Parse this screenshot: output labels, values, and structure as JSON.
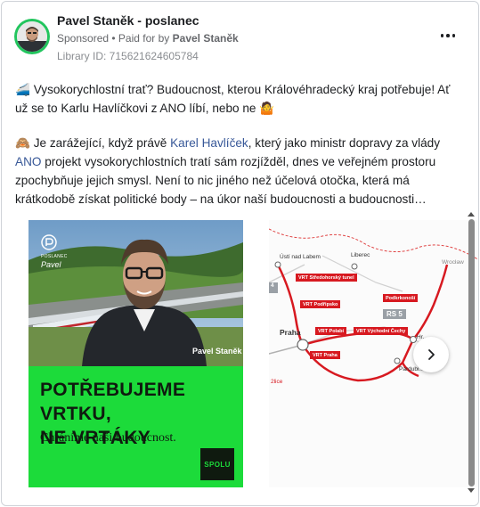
{
  "post": {
    "page_name": "Pavel Staněk - poslanec",
    "sponsored": "Sponsored",
    "paid_for_prefix": "• Paid for by",
    "paid_for_name": "Pavel Staněk",
    "library_id": "Library ID: 715621624605784",
    "more_icon": "more-horizontal-icon"
  },
  "body": {
    "p1_icon": "🚄",
    "p1_text": "Vysokorychlostní trať? Budoucnost, kterou Královéhradecký kraj potřebuje! Ať už se to Karlu Havlíčkovi z ANO líbí, nebo ne",
    "p1_end_icon": "🤷",
    "p2_icon": "🙈",
    "p2_a": "Je zarážející, když právě",
    "p2_link1": "Karel Havlíček",
    "p2_b": ", který jako ministr dopravy za vlády",
    "p2_link2": "ANO",
    "p2_c": "projekt vysokorychlostních tratí sám rozjížděl, dnes ve veřejném prostoru zpochybňuje jejich smysl. Není to nic jiného než účelová otočka, která má krátkodobě získat politické body – na úkor naší budoucnosti a budoucnosti…"
  },
  "ad_creative": {
    "logo_small_text": "POSLANEC",
    "logo_name": "Pavel",
    "person_name": "Pavel Staněk",
    "slogan_line1": "POTŘEBUJEME VRTKU,",
    "slogan_line2": "NE VRTÁKY",
    "subslogan": "Chráníme naši budoucnost.",
    "party": "SPOLU",
    "colors": {
      "green": "#1cdb3a",
      "dark": "#0f1a0f"
    }
  },
  "map": {
    "cities": {
      "usti": "Ústí nad Labem",
      "liberec": "Liberec",
      "wroclaw": "Wrocław",
      "praha": "Praha",
      "hk": "Hr...",
      "pardubice": "Pardubi...",
      "left_edge": "2lice",
      "left_num": "4"
    },
    "tags": {
      "severo": "VRT Středohorský tunel",
      "podkrk": "Podkrkonoší",
      "podripsko": "VRT Podřipsko",
      "rs5": "RS 5",
      "polabi": "VRT Polabí",
      "vychodni": "VRT Východní Čechy",
      "praha_vrt": "VRT Praha"
    },
    "colors": {
      "rail": "#d71920",
      "border": "#d71920"
    }
  },
  "carousel": {
    "next_icon": "chevron-right-icon"
  }
}
